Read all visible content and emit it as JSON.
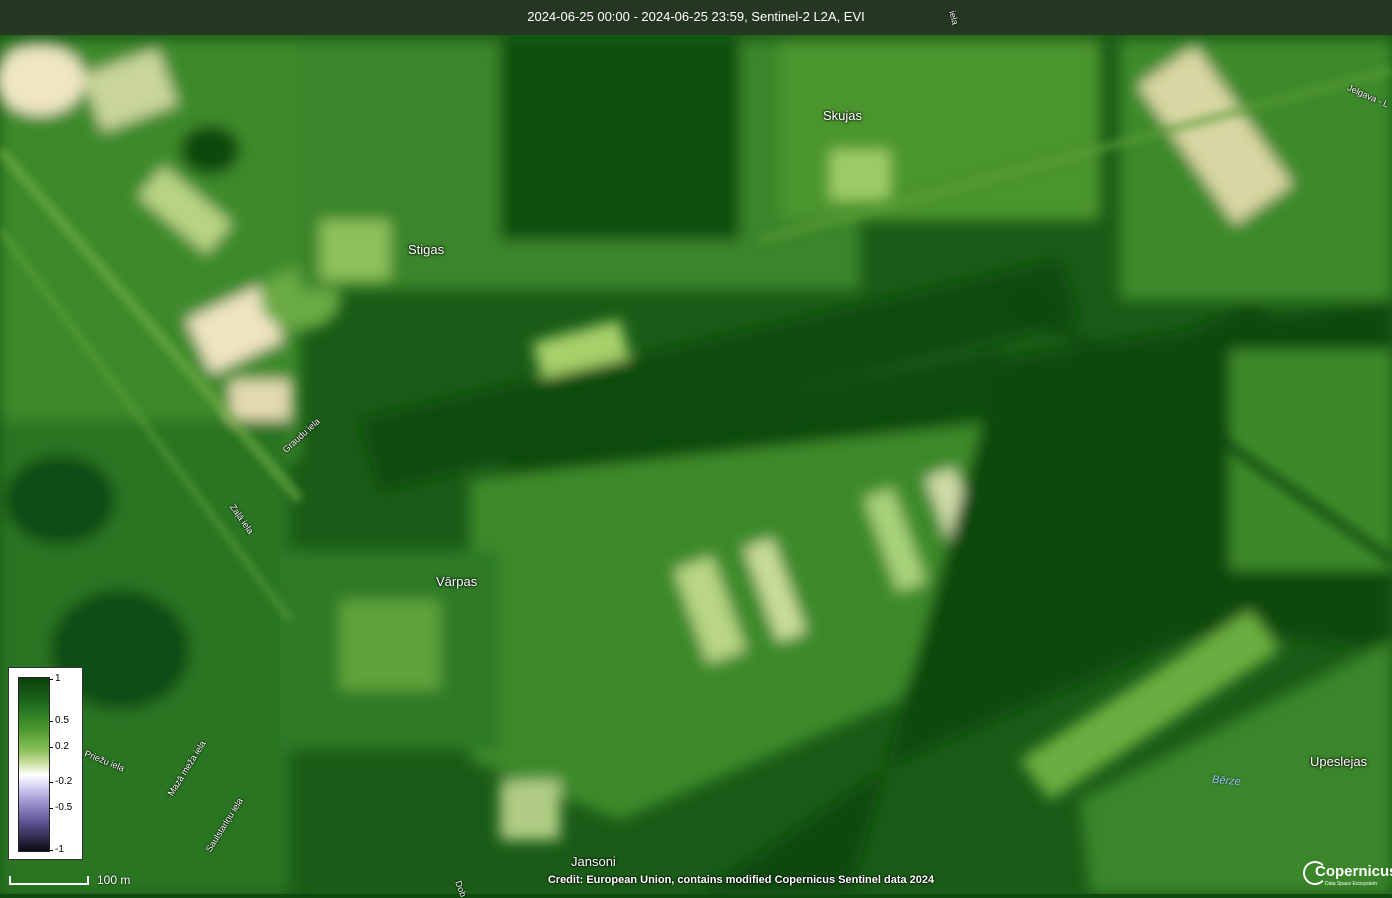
{
  "header": {
    "title": "2024-06-25 00:00 - 2024-06-25 23:59, Sentinel-2 L2A, EVI"
  },
  "places": [
    "Skujas",
    "Stigas",
    "Vārpas",
    "Jansoni",
    "Upeslejas"
  ],
  "roads": [
    "Jelgava - L",
    "Graudu iela",
    "Zaļā iela",
    "Priežu iela",
    "Mazā meža iela",
    "Saulstariņu iela",
    "Dob",
    "iela"
  ],
  "water": "Bērze",
  "legend": {
    "ticks": [
      "1",
      "0.5",
      "0.2",
      "-0.2",
      "-0.5",
      "-1"
    ]
  },
  "scale": {
    "label": "100 m"
  },
  "credit": "Credit: European Union, contains modified Copernicus Sentinel data 2024",
  "logo": {
    "word": "Copernicus",
    "sub": "Data Space Ecosystem"
  },
  "colors": {
    "dense_veg": "#0f4a10",
    "mid_veg": "#3f8a2a",
    "light_veg": "#9cc86a",
    "bare": "#e8dcae"
  }
}
